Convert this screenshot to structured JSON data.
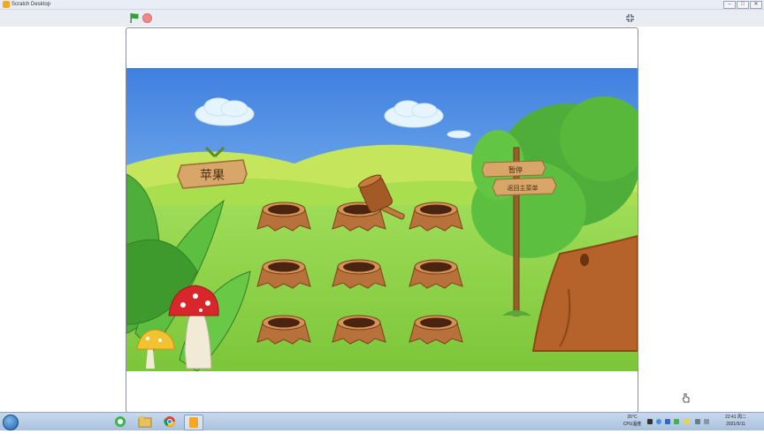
{
  "window": {
    "title": "Scratch Desktop",
    "minimize": "–",
    "maximize": "□",
    "close": "✕"
  },
  "toolbar": {
    "green_flag_icon": "green-flag-icon",
    "stop_icon": "stop-icon",
    "fullscreen_icon": "fullscreen-exit-icon",
    "flag_color": "#2fa336",
    "stop_color": "#f08a8a"
  },
  "stage": {
    "sign_left": "苹果",
    "sign_pause": "暂停",
    "sign_menu": "返回主菜单",
    "molehill_count": 9,
    "colors": {
      "sky_top": "#3f7fe0",
      "grass": "#8cd14a",
      "stump": "#b8713a"
    }
  },
  "taskbar": {
    "start_icon": "windows-start-icon",
    "apps": [
      "windows-start-icon",
      "360-browser-icon",
      "file-explorer-icon",
      "chrome-icon",
      "scratch-icon"
    ],
    "weather_temp": "26°C",
    "weather_label": "CPU温度",
    "time": "22:41 周二",
    "date": "2021/5/11"
  }
}
